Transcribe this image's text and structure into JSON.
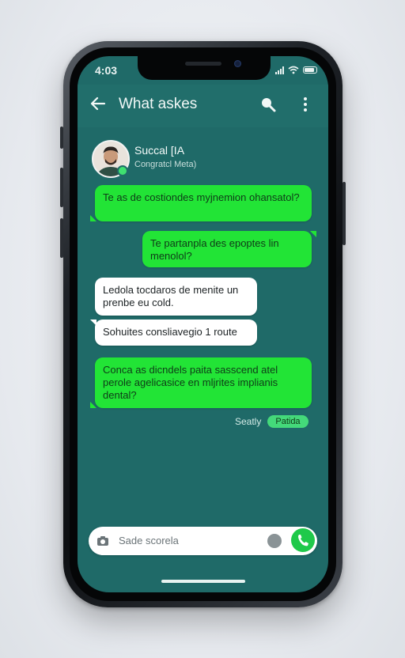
{
  "status": {
    "time": "4:03"
  },
  "header": {
    "title": "What askes",
    "icons": [
      "back-arrow-icon",
      "search-icon",
      "more-vertical-icon"
    ]
  },
  "contact": {
    "name": "Succal [IA",
    "subtitle": "Congratcl Meta)"
  },
  "messages": [
    {
      "side": "incoming",
      "style": "green",
      "text": "Te as de costiondes myjnemion ohansatol?"
    },
    {
      "side": "outgoing",
      "style": "green",
      "text": "Te partanpla des epoptes lin menolol?"
    },
    {
      "side": "incoming",
      "style": "white",
      "text": "Ledola tocdaros de menite un prenbe eu cold."
    },
    {
      "side": "incoming",
      "style": "white",
      "text": "Sohuites consliavegio 1 route"
    },
    {
      "side": "incoming",
      "style": "green",
      "text": "Conca as dicndels paita sasscend atel perole agelicasice en mljrites implianis dental?"
    }
  ],
  "meta": {
    "label": "Seatly",
    "badge": "Patida"
  },
  "composer": {
    "placeholder": "Sade scorela"
  },
  "colors": {
    "chat_bg": "#1f6a68",
    "header_bg": "#216e6b",
    "bubble_green": "#22e436",
    "call_green": "#1fc94a"
  }
}
